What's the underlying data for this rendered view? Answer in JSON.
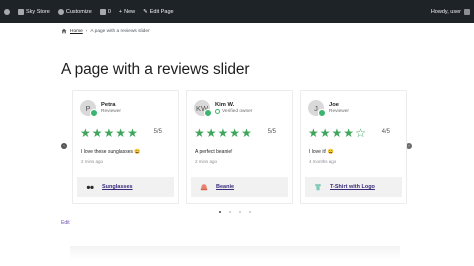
{
  "adminbar": {
    "site_name": "Sky Store",
    "customize": "Customize",
    "comments_count": "0",
    "new": "New",
    "edit_page": "Edit Page",
    "greeting": "Howdy, user"
  },
  "breadcrumb": {
    "home": "Home",
    "separator": "›",
    "current": "A page with a reviews slider"
  },
  "page": {
    "title": "A page with a reviews slider",
    "edit_link": "Edit"
  },
  "reviews": [
    {
      "initial": "P",
      "name": "Petra",
      "role": "Reviewer",
      "stars": 5,
      "rating_text": "5/5",
      "text": "I love these sunglasses 😄",
      "date": "2 mins ago",
      "product": "Sunglasses",
      "product_icon": "sunglasses-icon"
    },
    {
      "initial": "KW",
      "name": "Kim W.",
      "role": "Verified owner",
      "stars": 5,
      "rating_text": "5/5",
      "text": "A perfect beanie!",
      "date": "2 mins ago",
      "product": "Beanie",
      "product_icon": "beanie-icon"
    },
    {
      "initial": "J",
      "name": "Joe",
      "role": "Reviewer",
      "stars": 4,
      "rating_text": "4/5",
      "text": "I love it! 😄",
      "date": "4 months ago",
      "product": "T-Shirt with Logo",
      "product_icon": "tshirt-icon"
    }
  ],
  "slider": {
    "dot_count": 4,
    "active_dot": 1
  },
  "colors": {
    "star": "#3ea55b",
    "adminbar": "#1d2327",
    "product_link": "#3a2b7a"
  }
}
